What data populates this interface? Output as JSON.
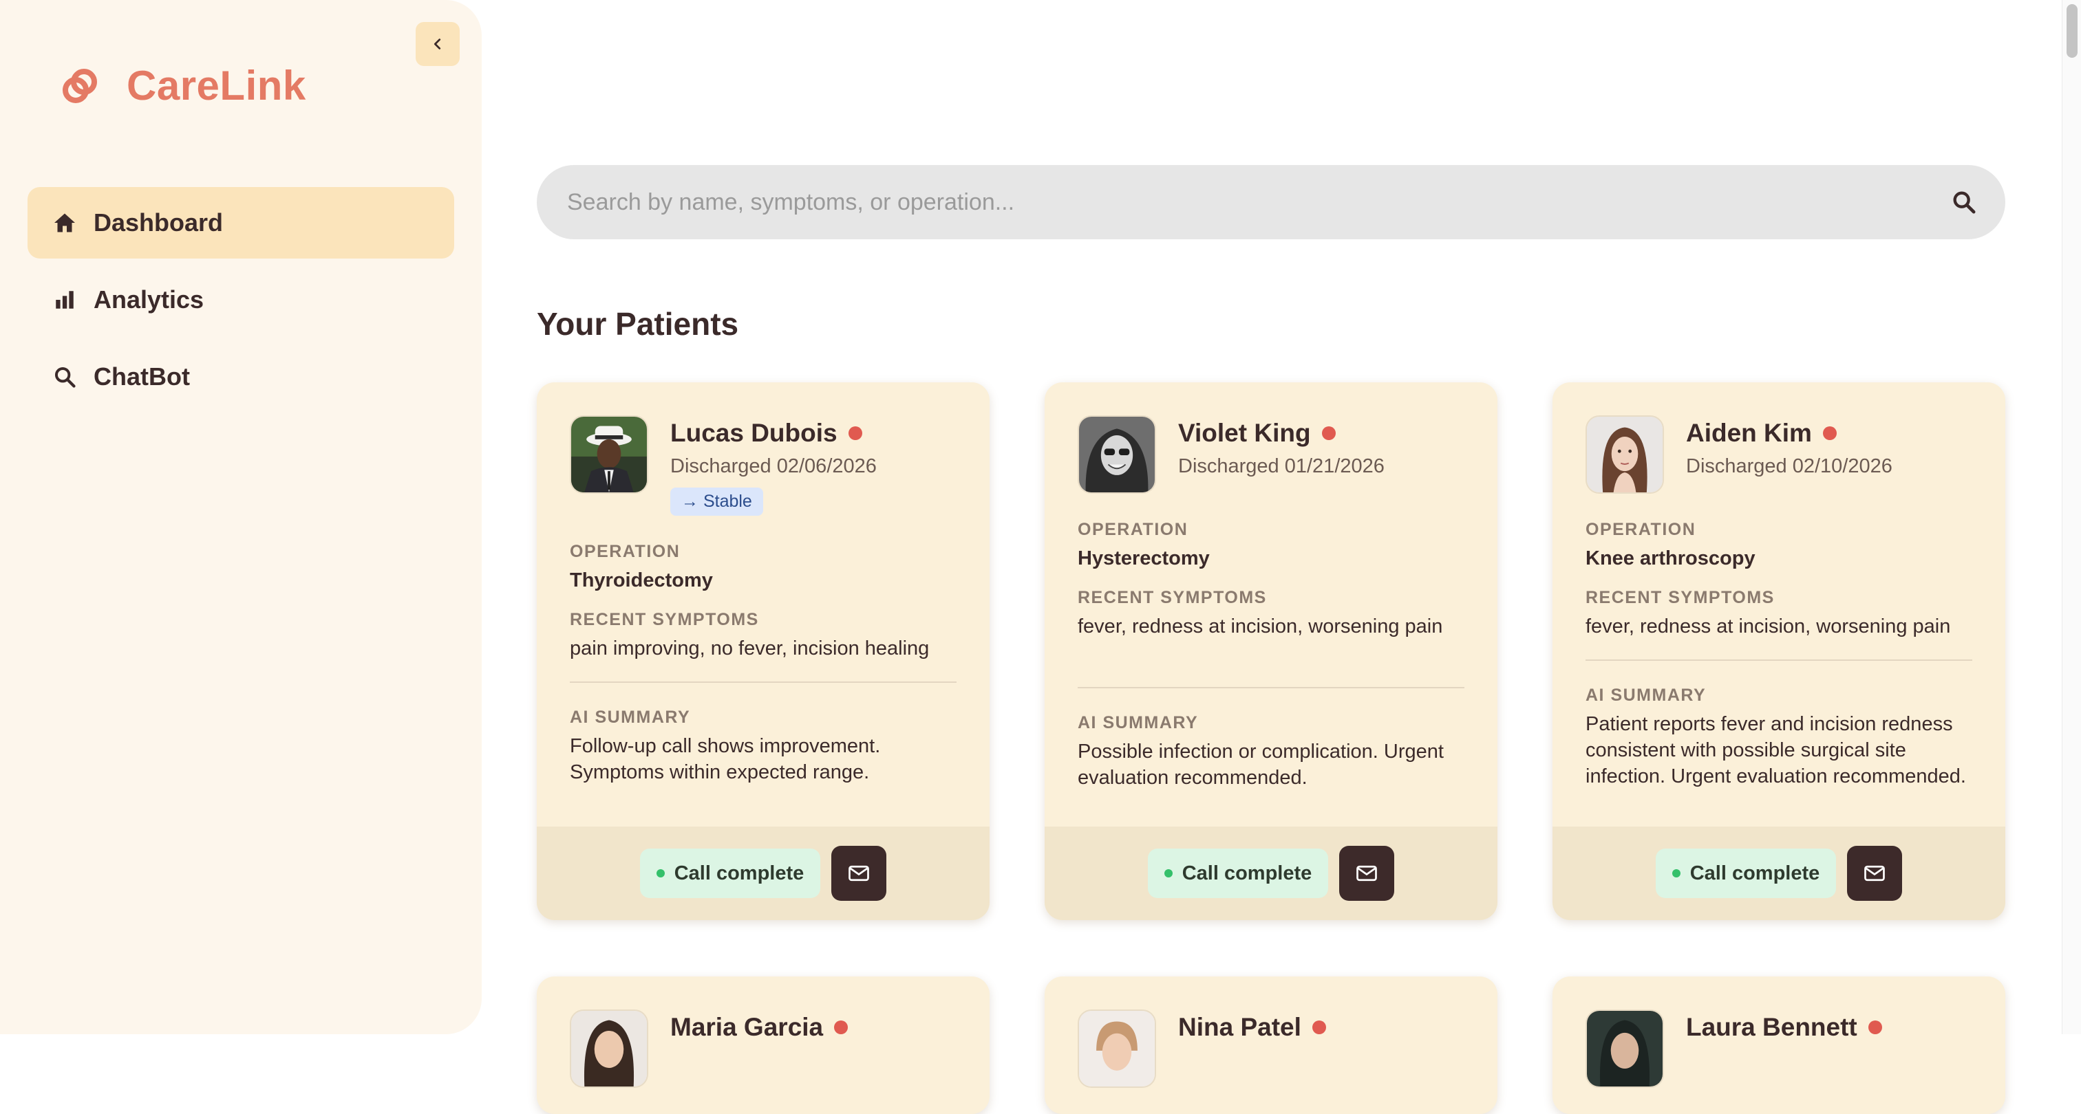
{
  "app": {
    "brand_name": "CareLink",
    "brand_color": "#e47a64",
    "accent_color": "#fbe4bb"
  },
  "sidebar": {
    "collapse_icon": "chevron-left-icon",
    "items": [
      {
        "label": "Dashboard",
        "icon": "home-icon",
        "active": true
      },
      {
        "label": "Analytics",
        "icon": "bar-chart-icon",
        "active": false
      },
      {
        "label": "ChatBot",
        "icon": "search-icon",
        "active": false
      }
    ]
  },
  "search": {
    "placeholder": "Search by name, symptoms, or operation...",
    "value": ""
  },
  "main": {
    "section_title": "Your Patients",
    "labels": {
      "operation": "OPERATION",
      "symptoms": "RECENT SYMPTOMS",
      "summary": "AI SUMMARY"
    },
    "patients": [
      {
        "name": "Lucas Dubois",
        "discharged": "Discharged 02/06/2026",
        "trend": "→ Stable",
        "operation": "Thyroidectomy",
        "symptoms": "pain improving, no fever, incision healing",
        "summary": "Follow-up call shows improvement. Symptoms within expected range.",
        "call_status": "Call complete",
        "status_color": "#e05a50"
      },
      {
        "name": "Violet King",
        "discharged": "Discharged 01/21/2026",
        "trend": "",
        "operation": "Hysterectomy",
        "symptoms": "fever, redness at incision, worsening pain",
        "summary": "Possible infection or complication. Urgent evaluation recommended.",
        "call_status": "Call complete",
        "status_color": "#e05a50"
      },
      {
        "name": "Aiden Kim",
        "discharged": "Discharged 02/10/2026",
        "trend": "",
        "operation": "Knee arthroscopy",
        "symptoms": "fever, redness at incision, worsening pain",
        "summary": "Patient reports fever and incision redness consistent with possible surgical site infection. Urgent evaluation recommended.",
        "call_status": "Call complete",
        "status_color": "#e05a50"
      }
    ],
    "patients_below": [
      {
        "name": "Maria Garcia"
      },
      {
        "name": "Nina Patel"
      },
      {
        "name": "Laura Bennett"
      }
    ]
  }
}
